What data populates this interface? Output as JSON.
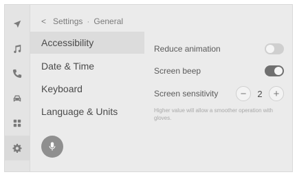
{
  "breadcrumb": {
    "back_glyph": "<",
    "parent": "Settings",
    "separator": "·",
    "current": "General"
  },
  "rail": {
    "icons": [
      "navigation-icon",
      "music-icon",
      "phone-icon",
      "car-icon",
      "apps-icon",
      "gear-icon"
    ],
    "active": "gear-icon"
  },
  "menu": {
    "items": [
      {
        "label": "Accessibility",
        "selected": true
      },
      {
        "label": "Date & Time",
        "selected": false
      },
      {
        "label": "Keyboard",
        "selected": false
      },
      {
        "label": "Language & Units",
        "selected": false
      }
    ]
  },
  "settings": {
    "reduce_animation": {
      "label": "Reduce animation",
      "state": "off"
    },
    "screen_beep": {
      "label": "Screen beep",
      "state": "on"
    },
    "screen_sensitivity": {
      "label": "Screen sensitivity",
      "value": "2",
      "minus": "−",
      "plus": "+",
      "hint": "Higher value will allow a smoother operation with gloves."
    }
  },
  "colors": {
    "background": "#ebebeb",
    "selected_item": "#dcdcdc",
    "toggle_on": "#6f6f6f",
    "toggle_off": "#cfcfcf"
  }
}
